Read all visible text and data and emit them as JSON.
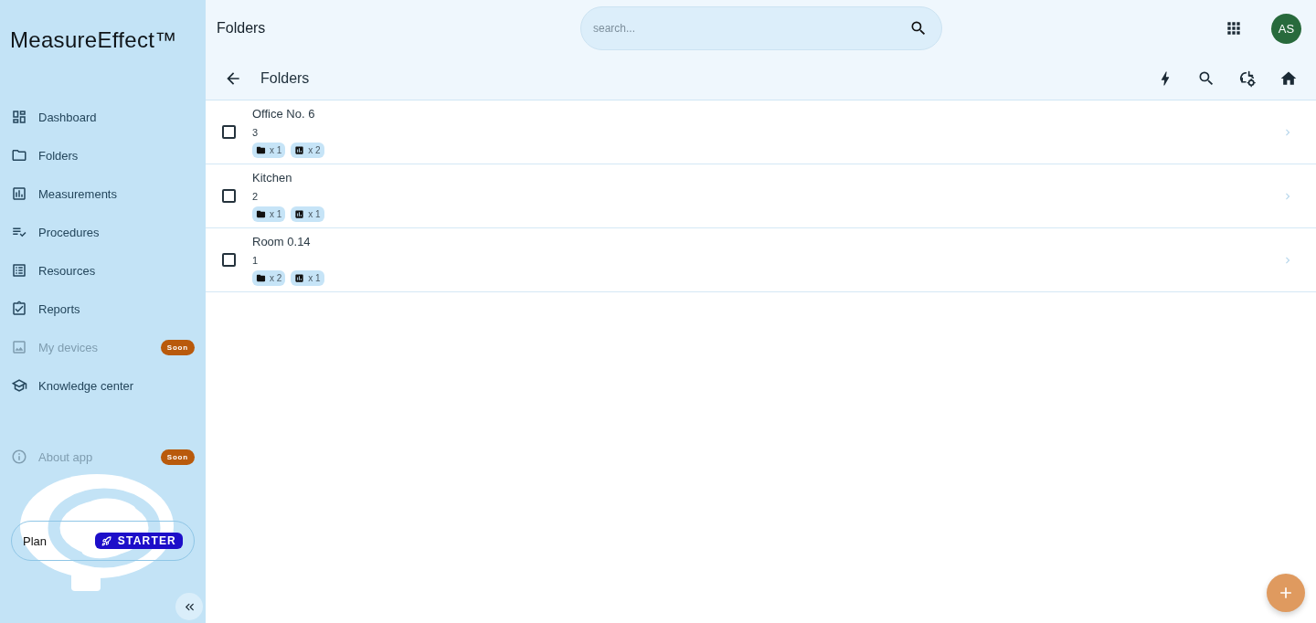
{
  "sidebar": {
    "logo": "MeasureEffect™",
    "items": [
      {
        "label": "Dashboard",
        "kind": "dashboard",
        "disabled": false
      },
      {
        "label": "Folders",
        "kind": "folder",
        "disabled": false
      },
      {
        "label": "Measurements",
        "kind": "chart",
        "disabled": false
      },
      {
        "label": "Procedures",
        "kind": "checklist",
        "disabled": false
      },
      {
        "label": "Resources",
        "kind": "list",
        "disabled": false
      },
      {
        "label": "Reports",
        "kind": "clipboard",
        "disabled": false
      },
      {
        "label": "My devices",
        "kind": "device",
        "disabled": true,
        "badge": "Soon"
      },
      {
        "label": "Knowledge center",
        "kind": "school",
        "disabled": false
      }
    ],
    "footer_items": [
      {
        "label": "About app",
        "kind": "info",
        "disabled": true,
        "badge": "Soon"
      }
    ],
    "plan": {
      "label": "Plan",
      "tier": "STARTER"
    }
  },
  "header": {
    "title": "Folders",
    "search": {
      "placeholder": "search..."
    },
    "avatar": "AS"
  },
  "toolbar": {
    "title": "Folders"
  },
  "folders": [
    {
      "name": "Office No. 6",
      "count": "3",
      "checked": false,
      "chips": [
        {
          "kind": "folder",
          "text": "x 1"
        },
        {
          "kind": "chart",
          "text": "x 2"
        }
      ]
    },
    {
      "name": "Kitchen",
      "count": "2",
      "checked": false,
      "chips": [
        {
          "kind": "folder",
          "text": "x 1"
        },
        {
          "kind": "chart",
          "text": "x 1"
        }
      ]
    },
    {
      "name": "Room 0.14",
      "count": "1",
      "checked": false,
      "chips": [
        {
          "kind": "folder",
          "text": "x 2"
        },
        {
          "kind": "chart",
          "text": "x 1"
        }
      ]
    }
  ]
}
